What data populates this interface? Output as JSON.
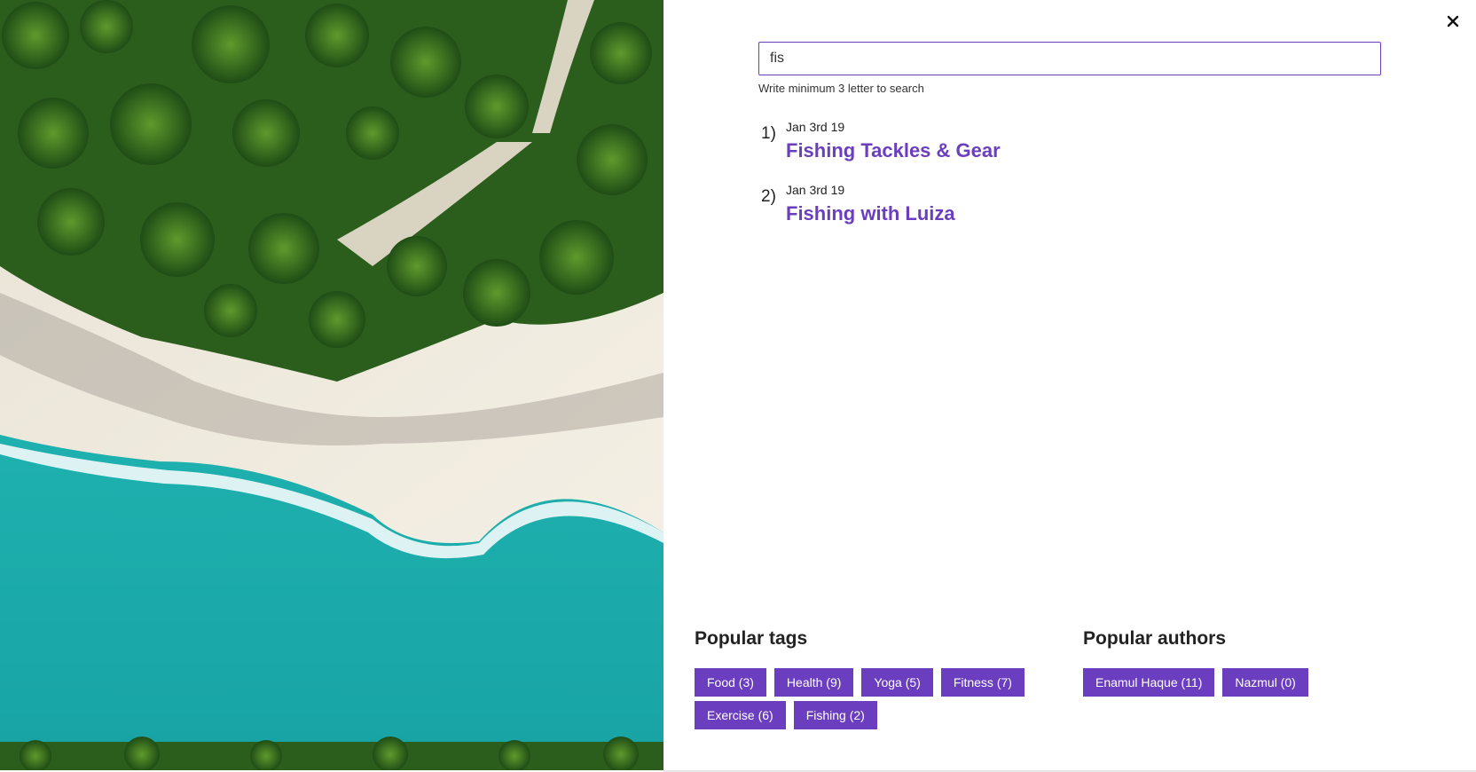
{
  "hero": {
    "image": "aerial-beach-palm-trees"
  },
  "close": {
    "icon": "close-icon"
  },
  "search": {
    "value": "fis",
    "hint": "Write minimum 3 letter to search"
  },
  "results": [
    {
      "num": "1)",
      "date": "Jan 3rd 19",
      "title": "Fishing Tackles & Gear"
    },
    {
      "num": "2)",
      "date": "Jan 3rd 19",
      "title": "Fishing with Luiza"
    }
  ],
  "popular_tags": {
    "heading": "Popular tags",
    "items": [
      "Food (3)",
      "Health (9)",
      "Yoga (5)",
      "Fitness (7)",
      "Exercise (6)",
      "Fishing (2)"
    ]
  },
  "popular_authors": {
    "heading": "Popular authors",
    "items": [
      "Enamul Haque (11)",
      "Nazmul (0)"
    ]
  },
  "colors": {
    "accent": "#6a3ebf",
    "text": "#222222",
    "sea": "#1fb5b3",
    "sand": "#f1ece1",
    "foliage": "#2f6b1e"
  }
}
